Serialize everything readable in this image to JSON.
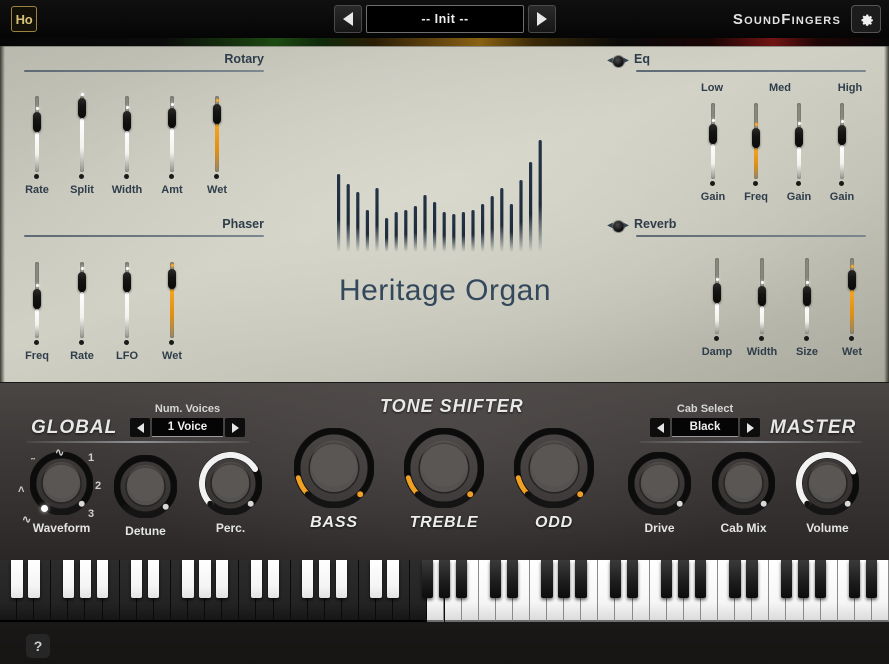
{
  "header": {
    "logo_badge": "Ho",
    "prev_icon": "triangle-left-icon",
    "next_icon": "triangle-right-icon",
    "preset_name": "-- Init --",
    "brand": "SoundFingers",
    "gear_icon": "gear-icon"
  },
  "center": {
    "product_name": "Heritage Organ",
    "logo_icon": "organ-pipes-waveform-icon"
  },
  "effects": {
    "rotary": {
      "title": "Rotary",
      "sliders": [
        {
          "label": "Rate",
          "value": 72,
          "color": "white"
        },
        {
          "label": "Split",
          "value": 96,
          "color": "white"
        },
        {
          "label": "Width",
          "value": 74,
          "color": "white"
        },
        {
          "label": "Amt",
          "value": 78,
          "color": "white"
        },
        {
          "label": "Wet",
          "value": 86,
          "color": "amber"
        }
      ]
    },
    "phaser": {
      "title": "Phaser",
      "sliders": [
        {
          "label": "Freq",
          "value": 52,
          "color": "white"
        },
        {
          "label": "Rate",
          "value": 82,
          "color": "white"
        },
        {
          "label": "LFO",
          "value": 82,
          "color": "white"
        },
        {
          "label": "Wet",
          "value": 88,
          "color": "amber"
        }
      ]
    },
    "eq": {
      "title": "Eq",
      "toggle_icon": "power-toggle-icon",
      "groups": [
        "Low",
        "Med",
        "High"
      ],
      "sliders": [
        {
          "label": "Gain",
          "value": 62,
          "color": "white"
        },
        {
          "label": "Freq",
          "value": 55,
          "color": "amber"
        },
        {
          "label": "Gain",
          "value": 58,
          "color": "white"
        },
        {
          "label": "Gain",
          "value": 60,
          "color": "white"
        }
      ]
    },
    "reverb": {
      "title": "Reverb",
      "toggle_icon": "power-toggle-icon",
      "sliders": [
        {
          "label": "Damp",
          "value": 56,
          "color": "white"
        },
        {
          "label": "Width",
          "value": 50,
          "color": "white"
        },
        {
          "label": "Size",
          "value": 50,
          "color": "white"
        },
        {
          "label": "Wet",
          "value": 78,
          "color": "amber"
        }
      ]
    }
  },
  "global": {
    "title": "GLOBAL",
    "voices_label": "Num. Voices",
    "voices_value": "1 Voice",
    "prev_icon": "triangle-left-icon",
    "next_icon": "triangle-right-icon",
    "waveform_marks": [
      "1",
      "2",
      "3"
    ],
    "knobs": [
      {
        "label": "Waveform",
        "value": 0,
        "arc": "none"
      },
      {
        "label": "Detune",
        "value": 0,
        "arc": "none"
      },
      {
        "label": "Perc.",
        "value": 0.72,
        "arc": "white"
      }
    ]
  },
  "tone_shifter": {
    "title": "TONE SHIFTER",
    "knobs": [
      {
        "label": "BASS",
        "value": 0.08,
        "arc": "amber"
      },
      {
        "label": "TREBLE",
        "value": 0.08,
        "arc": "amber"
      },
      {
        "label": "ODD",
        "value": 0.08,
        "arc": "amber"
      }
    ]
  },
  "master": {
    "title": "MASTER",
    "cab_label": "Cab Select",
    "cab_value": "Black",
    "prev_icon": "triangle-left-icon",
    "next_icon": "triangle-right-icon",
    "knobs": [
      {
        "label": "Drive",
        "value": 0,
        "arc": "none"
      },
      {
        "label": "Cab Mix",
        "value": 0,
        "arc": "none"
      },
      {
        "label": "Volume",
        "value": 0.74,
        "arc": "white"
      }
    ]
  },
  "keyboard": {
    "total_white_keys": 52,
    "inverted_white_keys": 25,
    "help_label": "?"
  },
  "colors": {
    "accent_amber": "#f5a623",
    "panel_light": "#c9c9be",
    "panel_dark": "#3e3a39",
    "label_blue": "#2f3d4a"
  }
}
